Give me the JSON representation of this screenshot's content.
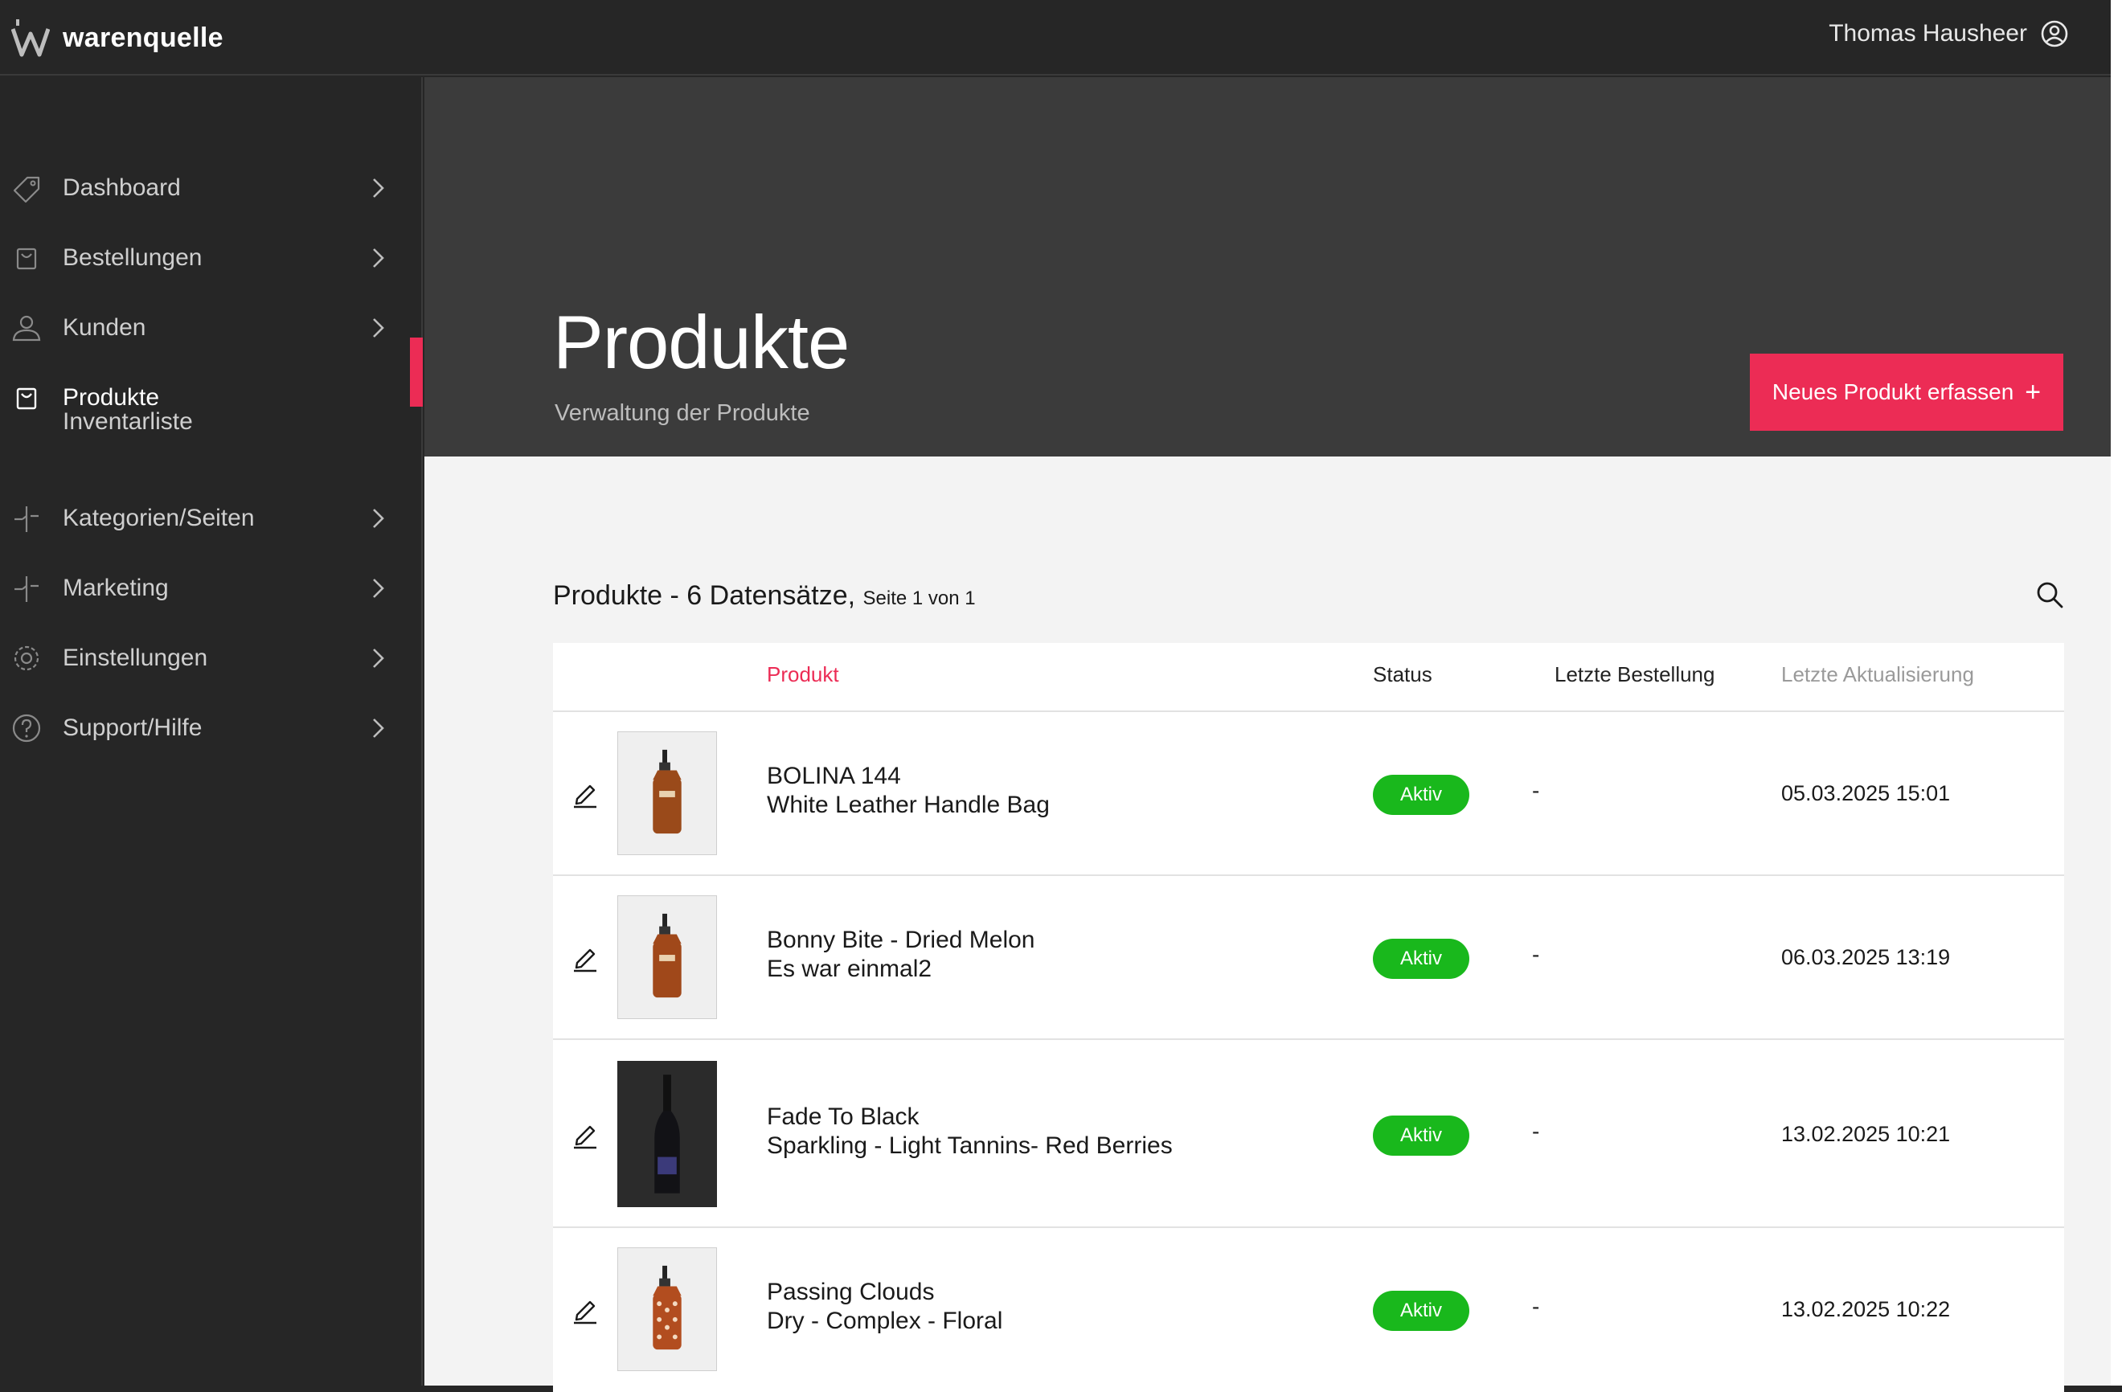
{
  "app": {
    "brand": "warenquelle"
  },
  "user": {
    "name": "Thomas Hausheer"
  },
  "sidebar": {
    "items": [
      {
        "label": "Dashboard"
      },
      {
        "label": "Bestellungen"
      },
      {
        "label": "Kunden"
      },
      {
        "label": "Produkte"
      },
      {
        "label": "Kategorien/Seiten"
      },
      {
        "label": "Marketing"
      },
      {
        "label": "Einstellungen"
      },
      {
        "label": "Support/Hilfe"
      }
    ],
    "subitem": "Inventarliste"
  },
  "page": {
    "title": "Produkte",
    "subtitle": "Verwaltung der Produkte",
    "new_button": "Neues Produkt erfassen",
    "new_button_icon": "+"
  },
  "list": {
    "heading": "Produkte - 6 Datensätze,",
    "pager": "Seite 1 von 1"
  },
  "table": {
    "columns": {
      "product": "Produkt",
      "status": "Status",
      "last_order": "Letzte Bestellung",
      "last_update": "Letzte Aktualisierung"
    },
    "rows": [
      {
        "name": "BOLINA 144",
        "detail": "White Leather Handle Bag",
        "status": "Aktiv",
        "last_order": "-",
        "updated": "05.03.2025 15:01"
      },
      {
        "name": "Bonny Bite - Dried Melon",
        "detail": "Es war einmal2",
        "status": "Aktiv",
        "last_order": "-",
        "updated": "06.03.2025 13:19"
      },
      {
        "name": "Fade To Black",
        "detail": "Sparkling - Light Tannins- Red Berries",
        "status": "Aktiv",
        "last_order": "-",
        "updated": "13.02.2025 10:21"
      },
      {
        "name": "Passing Clouds",
        "detail": "Dry - Complex - Floral",
        "status": "Aktiv",
        "last_order": "-",
        "updated": "13.02.2025 10:22"
      }
    ]
  },
  "colors": {
    "accent": "#ec2c55",
    "status_active": "#19b81c",
    "sidebar_bg": "#262626",
    "hero_bg": "#3b3b3b"
  }
}
